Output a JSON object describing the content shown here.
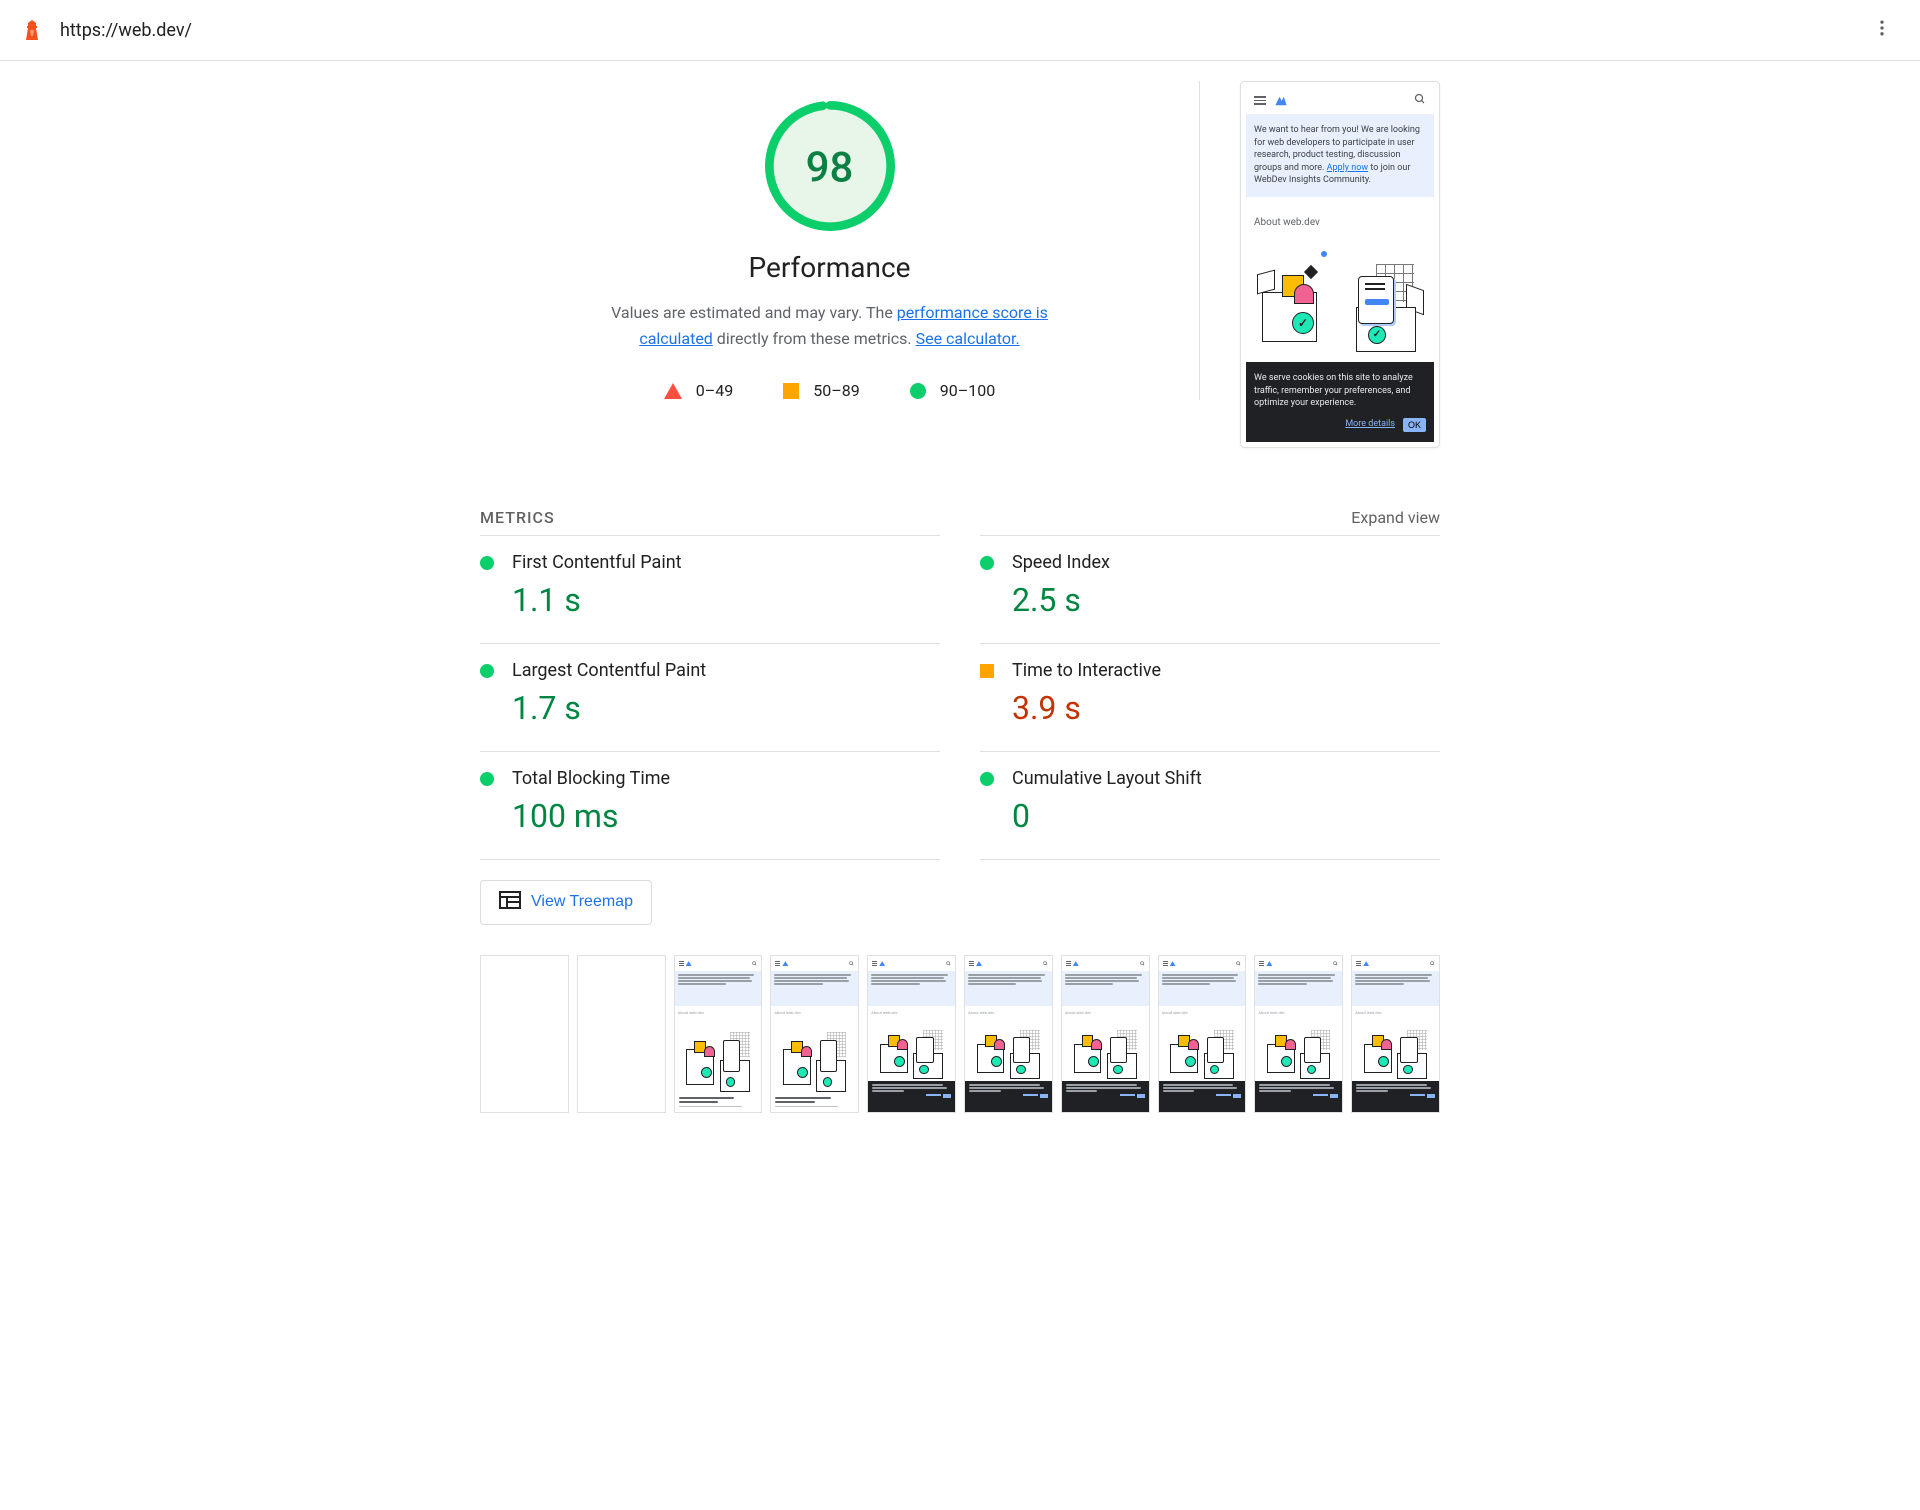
{
  "url": "https://web.dev/",
  "gauge": {
    "score": "98",
    "category": "Performance"
  },
  "description": {
    "prefix": "Values are estimated and may vary. The ",
    "link1": "performance score is calculated",
    "middle": " directly from these metrics. ",
    "link2": "See calculator."
  },
  "legend": {
    "fail": "0–49",
    "average": "50–89",
    "pass": "90–100"
  },
  "preview": {
    "banner_text": "We want to hear from you! We are looking for web developers to participate in user research, product testing, discussion groups and more. ",
    "banner_link": "Apply now",
    "banner_suffix": " to join our WebDev Insights Community.",
    "about": "About web.dev",
    "cookie_text": "We serve cookies on this site to analyze traffic, remember your preferences, and optimize your experience.",
    "more_details": "More details",
    "ok": "OK"
  },
  "metrics_header": {
    "title": "METRICS",
    "expand": "Expand view"
  },
  "metrics": [
    {
      "name": "First Contentful Paint",
      "value": "1.1 s",
      "status": "pass"
    },
    {
      "name": "Speed Index",
      "value": "2.5 s",
      "status": "pass"
    },
    {
      "name": "Largest Contentful Paint",
      "value": "1.7 s",
      "status": "pass"
    },
    {
      "name": "Time to Interactive",
      "value": "3.9 s",
      "status": "average"
    },
    {
      "name": "Total Blocking Time",
      "value": "100 ms",
      "status": "pass"
    },
    {
      "name": "Cumulative Layout Shift",
      "value": "0",
      "status": "pass"
    }
  ],
  "treemap_button": "View Treemap",
  "filmstrip_variants": [
    "blank",
    "blank",
    "text",
    "text",
    "cookie",
    "cookie",
    "cookie",
    "cookie",
    "cookie",
    "cookie"
  ]
}
